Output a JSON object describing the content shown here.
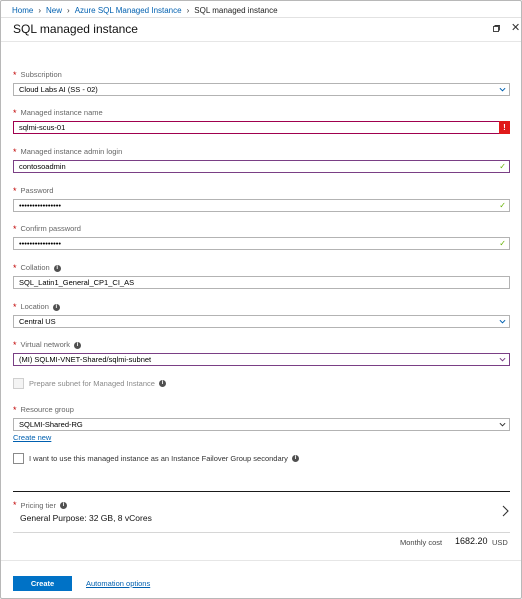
{
  "breadcrumb": {
    "items": [
      "Home",
      "New",
      "Azure SQL Managed Instance"
    ],
    "current": "SQL managed instance"
  },
  "blade": {
    "title": "SQL managed instance"
  },
  "form": {
    "subscription": {
      "label": "Subscription",
      "value": "Cloud Labs AI (SS - 02)"
    },
    "instance_name": {
      "label": "Managed instance name",
      "value": "sqlmi-scus-01",
      "error_badge": "!"
    },
    "admin_login": {
      "label": "Managed instance admin login",
      "value": "contosoadmin"
    },
    "password": {
      "label": "Password",
      "value": "••••••••••••••••"
    },
    "confirm_password": {
      "label": "Confirm password",
      "value": "••••••••••••••••"
    },
    "collation": {
      "label": "Collation",
      "value": "SQL_Latin1_General_CP1_CI_AS"
    },
    "location": {
      "label": "Location",
      "value": "Central US"
    },
    "virtual_network": {
      "label": "Virtual network",
      "value": "(MI) SQLMI-VNET-Shared/sqlmi-subnet"
    },
    "prepare_subnet": {
      "label": "Prepare subnet for Managed Instance"
    },
    "resource_group": {
      "label": "Resource group",
      "value": "SQLMI-Shared-RG",
      "create_new": "Create new"
    },
    "failover_group": {
      "label": "I want to use this managed instance as an Instance Failover Group secondary"
    }
  },
  "pricing": {
    "label": "Pricing tier",
    "value": "General Purpose: 32 GB, 8 vCores"
  },
  "cost": {
    "label": "Monthly cost",
    "value": "1682.20",
    "unit": "USD"
  },
  "footer": {
    "create_label": "Create",
    "automation_label": "Automation options"
  },
  "colors": {
    "accent": "#0072c6",
    "link": "#0060b0",
    "error": "#e01a1a",
    "valid": "#64b100",
    "required": "#c00000"
  }
}
